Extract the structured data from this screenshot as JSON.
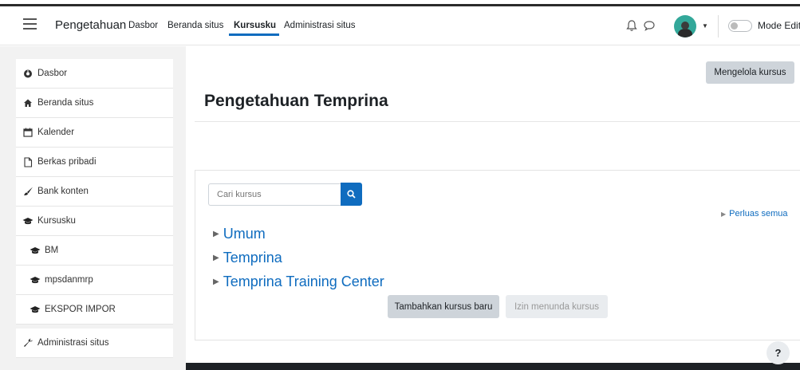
{
  "navbar": {
    "brand": "Pengetahuan",
    "links": [
      {
        "label": "Dasbor"
      },
      {
        "label": "Beranda situs"
      },
      {
        "label": "Kursusku"
      },
      {
        "label": "Administrasi situs"
      }
    ],
    "active_link": "Kursusku",
    "mode_label": "Mode Edit",
    "icons": [
      "menu-icon",
      "bell-icon",
      "chat-icon",
      "avatar",
      "chevron-down-icon"
    ],
    "colors": {
      "accent": "#0f6cbf"
    }
  },
  "sidebar": {
    "items": [
      {
        "label": "Dasbor",
        "icon": "dashboard-icon"
      },
      {
        "label": "Beranda situs",
        "icon": "home-icon"
      },
      {
        "label": "Kalender",
        "icon": "calendar-icon"
      },
      {
        "label": "Berkas pribadi",
        "icon": "file-icon"
      },
      {
        "label": "Bank konten",
        "icon": "brush-icon"
      },
      {
        "label": "Kursusku",
        "icon": "graduation-cap-icon"
      },
      {
        "label": "BM",
        "icon": "graduation-cap-icon"
      },
      {
        "label": "mpsdanmrp",
        "icon": "graduation-cap-icon"
      },
      {
        "label": "EKSPOR IMPOR",
        "icon": "graduation-cap-icon"
      },
      {
        "label": "Administrasi situs",
        "icon": "wrench-icon"
      }
    ]
  },
  "header": {
    "title": "Pengetahuan Temprina",
    "manage_button": "Mengelola kursus"
  },
  "courses": {
    "search_placeholder": "Cari kursus",
    "expand_all": "Perluas semua",
    "categories": [
      "Umum",
      "Temprina",
      "Temprina Training Center"
    ],
    "add_button": "Tambahkan kursus baru",
    "pending_button": "Izin menunda kursus"
  },
  "help": {
    "label": "?"
  }
}
